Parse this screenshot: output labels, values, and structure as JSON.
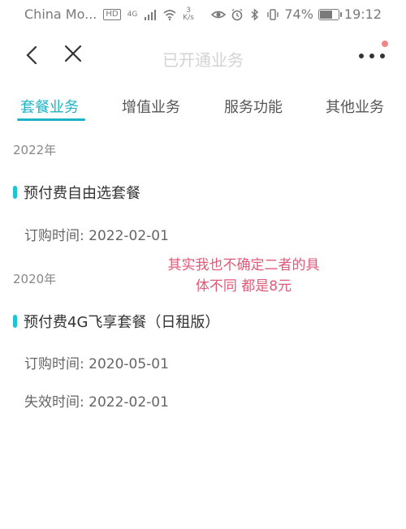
{
  "status_bar": {
    "carrier": "China Mo...",
    "hd": "HD",
    "net_type": "4G",
    "net_speed_value": "3",
    "net_speed_unit": "K/s",
    "battery_percent": "74%",
    "battery_level": 0.74,
    "time": "19:12"
  },
  "nav": {
    "title": "已开通业务"
  },
  "tabs": [
    {
      "label": "套餐业务",
      "active": true
    },
    {
      "label": "增值业务",
      "active": false
    },
    {
      "label": "服务功能",
      "active": false
    },
    {
      "label": "其他业务",
      "active": false
    }
  ],
  "groups": [
    {
      "year": "2022年",
      "plan_name": "预付费自由选套餐",
      "details": [
        "订购时间: 2022-02-01"
      ]
    },
    {
      "year": "2020年",
      "plan_name": "预付费4G飞享套餐（日租版）",
      "details": [
        "订购时间: 2020-05-01",
        "失效时间: 2022-02-01"
      ]
    }
  ],
  "annotation": {
    "line1": "其实我也不确定二者的具",
    "line2": "体不同 都是8元"
  },
  "colors": {
    "accent": "#1cb4c4",
    "annotation": "#e05a78"
  }
}
